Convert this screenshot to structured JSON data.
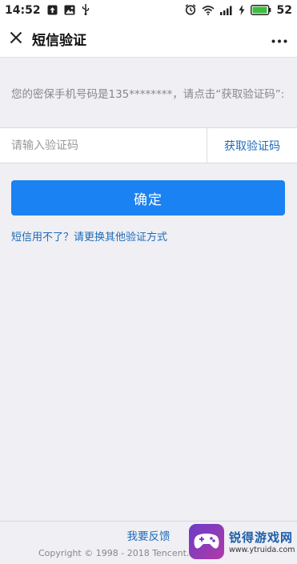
{
  "status_bar": {
    "time": "14:52",
    "battery_level": "52",
    "left_icons": [
      "upload-icon",
      "image-icon",
      "usb-icon"
    ],
    "right_icons": [
      "alarm-icon",
      "wifi-icon",
      "signal-icon",
      "charging-icon",
      "battery-icon"
    ]
  },
  "header": {
    "title": "短信验证",
    "close_icon": "close-icon",
    "more_icon": "more-icon"
  },
  "info_text": "您的密保手机号码是135********，请点击“获取验证码”:",
  "code_input": {
    "placeholder": "请输入验证码",
    "value": ""
  },
  "get_code_label": "获取验证码",
  "confirm_label": "确定",
  "alt_link": "短信用不了？请更换其他验证方式",
  "footer": {
    "feedback": "我要反馈",
    "copyright": "Copyright © 1998 - 2018 Tencent. Al"
  },
  "watermark": {
    "name": "锐得游戏网",
    "url": "www.ytruida.com"
  },
  "colors": {
    "accent": "#1a82f2",
    "link": "#1e6bb8",
    "background": "#efeff4"
  }
}
